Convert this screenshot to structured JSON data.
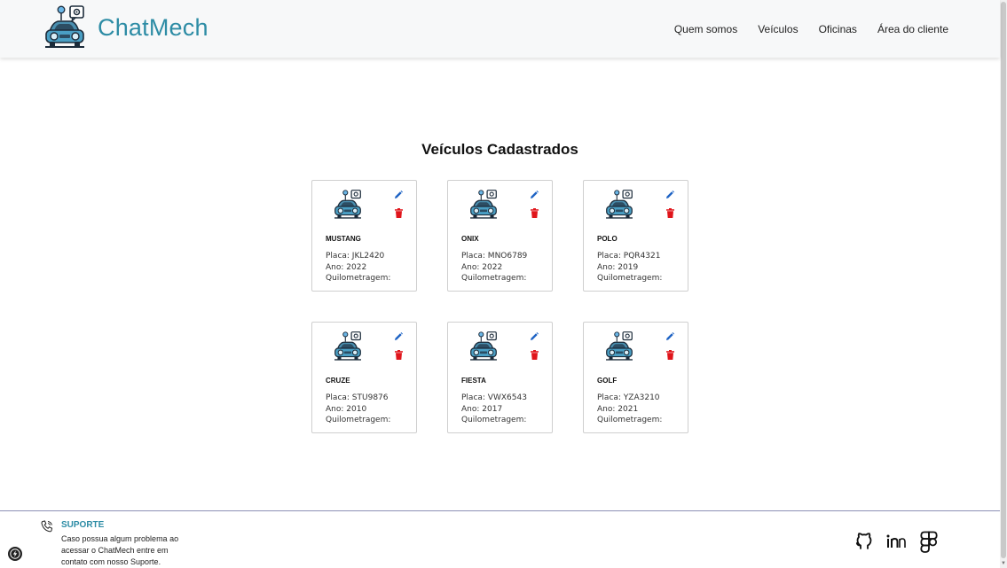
{
  "header": {
    "brand": "ChatMech",
    "nav": [
      "Quem somos",
      "Veículos",
      "Oficinas",
      "Área do cliente"
    ]
  },
  "main": {
    "title": "Veículos Cadastrados",
    "vehicles": [
      {
        "model": "MUSTANG",
        "plate": "Placa: JKL2420",
        "year": "Ano: 2022",
        "mileage": "Quilometragem:"
      },
      {
        "model": "ONIX",
        "plate": "Placa: MNO6789",
        "year": "Ano: 2022",
        "mileage": "Quilometragem:"
      },
      {
        "model": "POLO",
        "plate": "Placa: PQR4321",
        "year": "Ano: 2019",
        "mileage": "Quilometragem:"
      },
      {
        "model": "CRUZE",
        "plate": "Placa: STU9876",
        "year": "Ano: 2010",
        "mileage": "Quilometragem:"
      },
      {
        "model": "FIESTA",
        "plate": "Placa: VWX6543",
        "year": "Ano: 2017",
        "mileage": "Quilometragem:"
      },
      {
        "model": "GOLF",
        "plate": "Placa: YZA3210",
        "year": "Ano: 2021",
        "mileage": "Quilometragem:"
      }
    ]
  },
  "footer": {
    "support_title": "SUPORTE",
    "support_text": "Caso possua algum problema ao acessar o ChatMech entre em contato com nosso Suporte.",
    "social_icons": [
      "github-icon",
      "linkedin-icon",
      "figma-icon"
    ]
  },
  "colors": {
    "brand": "#2d8ca5",
    "edit": "#1e63c4",
    "delete": "#e0151b",
    "footer_border": "#8d8fb5"
  }
}
